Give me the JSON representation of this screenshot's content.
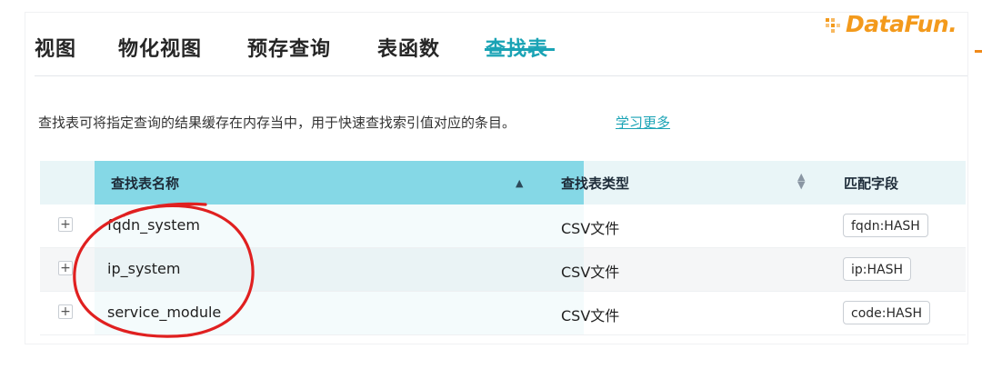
{
  "tabs": [
    {
      "label": "视图",
      "active": false
    },
    {
      "label": "物化视图",
      "active": false
    },
    {
      "label": "预存查询",
      "active": false
    },
    {
      "label": "表函数",
      "active": false
    },
    {
      "label": "查找表",
      "active": true
    }
  ],
  "logo": {
    "text": "DataFun."
  },
  "description": {
    "text": "查找表可将指定查询的结果缓存在内存当中，用于快速查找索引值对应的条目。",
    "learn_more": "学习更多"
  },
  "table": {
    "columns": [
      {
        "label": "查找表名称",
        "sort": "ascending"
      },
      {
        "label": "查找表类型",
        "sort": "none"
      },
      {
        "label": "匹配字段",
        "sort": "none"
      }
    ],
    "rows": [
      {
        "name": "fqdn_system",
        "type": "CSV文件",
        "field": "fqdn:HASH"
      },
      {
        "name": "ip_system",
        "type": "CSV文件",
        "field": "ip:HASH"
      },
      {
        "name": "service_module",
        "type": "CSV文件",
        "field": "code:HASH"
      }
    ],
    "expand_symbol": "+"
  },
  "colors": {
    "accent": "#1aa3b5",
    "sorted_header": "#85d8e6",
    "annotation": "#e02020",
    "logo": "#f39a1c"
  }
}
